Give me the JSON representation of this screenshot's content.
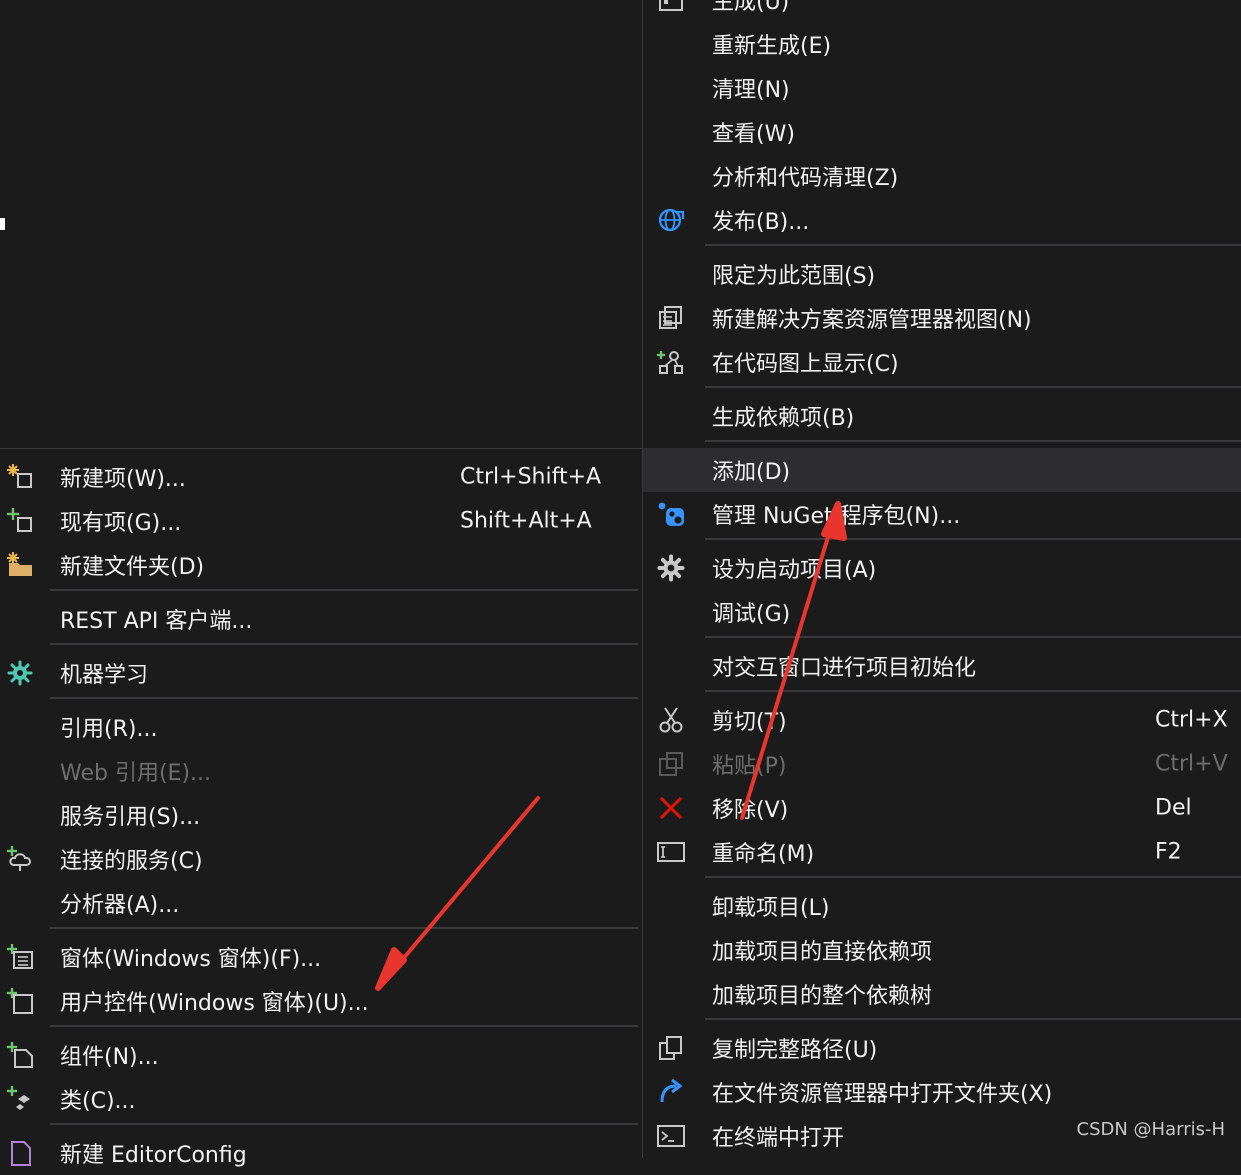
{
  "context_menu": {
    "items": [
      {
        "label": "生成(U)",
        "icon": "build-icon"
      },
      {
        "label": "重新生成(E)"
      },
      {
        "label": "清理(N)"
      },
      {
        "label": "查看(W)"
      },
      {
        "label": "分析和代码清理(Z)"
      },
      {
        "label": "发布(B)...",
        "icon": "publish-globe-icon"
      },
      {
        "label": "限定为此范围(S)"
      },
      {
        "label": "新建解决方案资源管理器视图(N)",
        "icon": "new-view-icon"
      },
      {
        "label": "在代码图上显示(C)",
        "icon": "code-map-icon"
      },
      {
        "label": "生成依赖项(B)"
      },
      {
        "label": "添加(D)"
      },
      {
        "label": "管理 NuGet 程序包(N)...",
        "icon": "nuget-icon"
      },
      {
        "label": "设为启动项目(A)",
        "icon": "gear-icon"
      },
      {
        "label": "调试(G)"
      },
      {
        "label": "对交互窗口进行项目初始化"
      },
      {
        "label": "剪切(T)",
        "shortcut": "Ctrl+X",
        "icon": "scissors-icon"
      },
      {
        "label": "粘贴(P)",
        "shortcut": "Ctrl+V",
        "icon": "paste-icon"
      },
      {
        "label": "移除(V)",
        "shortcut": "Del",
        "icon": "remove-x-icon"
      },
      {
        "label": "重命名(M)",
        "shortcut": "F2",
        "icon": "rename-icon"
      },
      {
        "label": "卸载项目(L)"
      },
      {
        "label": "加载项目的直接依赖项"
      },
      {
        "label": "加载项目的整个依赖树"
      },
      {
        "label": "复制完整路径(U)",
        "icon": "copy-icon"
      },
      {
        "label": "在文件资源管理器中打开文件夹(X)",
        "icon": "open-folder-arrow-icon"
      },
      {
        "label": "在终端中打开",
        "icon": "terminal-icon"
      }
    ]
  },
  "add_submenu": {
    "items": [
      {
        "label": "新建项(W)...",
        "shortcut": "Ctrl+Shift+A",
        "icon": "new-item-icon"
      },
      {
        "label": "现有项(G)...",
        "shortcut": "Shift+Alt+A",
        "icon": "existing-item-icon"
      },
      {
        "label": "新建文件夹(D)",
        "icon": "new-folder-icon"
      },
      {
        "label": "REST API 客户端..."
      },
      {
        "label": "机器学习",
        "icon": "machine-learning-icon"
      },
      {
        "label": "引用(R)..."
      },
      {
        "label": "Web 引用(E)..."
      },
      {
        "label": "服务引用(S)..."
      },
      {
        "label": "连接的服务(C)",
        "icon": "connected-service-icon"
      },
      {
        "label": "分析器(A)..."
      },
      {
        "label": "窗体(Windows 窗体)(F)...",
        "icon": "form-icon"
      },
      {
        "label": "用户控件(Windows 窗体)(U)...",
        "icon": "user-control-icon"
      },
      {
        "label": "组件(N)...",
        "icon": "component-icon"
      },
      {
        "label": "类(C)...",
        "icon": "class-icon"
      },
      {
        "label": "新建 EditorConfig",
        "icon": "editorconfig-icon"
      }
    ]
  },
  "watermark": "CSDN @Harris-H",
  "colors": {
    "background": "#1b1b1c",
    "highlight": "#2d2d30",
    "separator": "#3a3a3d",
    "text": "#f1f1f1",
    "disabled_text": "#6d6d6d",
    "accent_blue": "#3794ff",
    "remove_red": "#e51400",
    "arrow_red": "#e8352e"
  }
}
